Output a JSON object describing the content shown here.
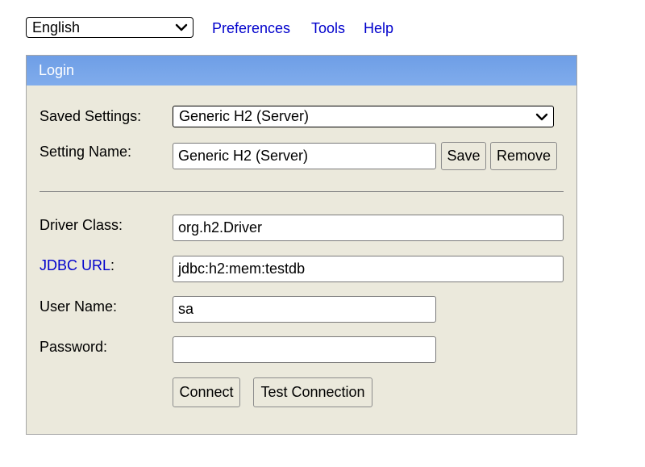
{
  "topbar": {
    "language": "English",
    "links": [
      "Preferences",
      "Tools",
      "Help"
    ]
  },
  "login": {
    "header": "Login",
    "saved_settings_label": "Saved Settings:",
    "saved_settings_value": "Generic H2 (Server)",
    "setting_name_label": "Setting Name:",
    "setting_name_value": "Generic H2 (Server)",
    "save_label": "Save",
    "remove_label": "Remove",
    "driver_class_label": "Driver Class:",
    "driver_class_value": "org.h2.Driver",
    "jdbc_url_link": "JDBC URL",
    "jdbc_url_colon": ":",
    "jdbc_url_value": "jdbc:h2:mem:testdb",
    "user_name_label": "User Name:",
    "user_name_value": "sa",
    "password_label": "Password:",
    "password_value": "",
    "connect_label": "Connect",
    "test_connection_label": "Test Connection"
  },
  "colors": {
    "panel_bg": "#ebe9dc",
    "header_bg": "#7aa6ea",
    "link": "#0000cc"
  },
  "icons": {
    "dropdown": "chevron-down-icon"
  }
}
